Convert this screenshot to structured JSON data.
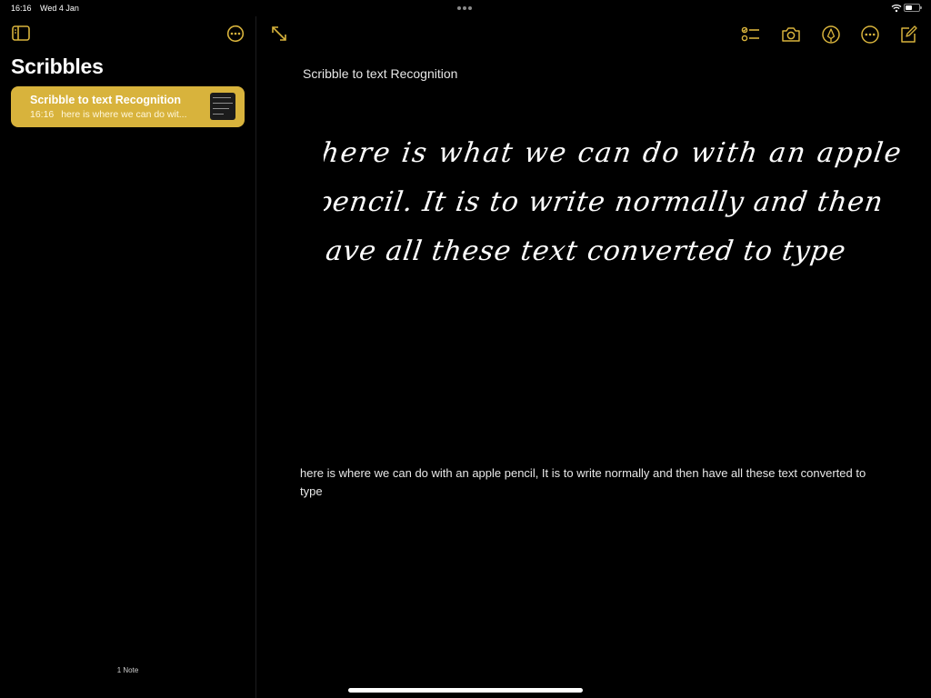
{
  "status_bar": {
    "time": "16:16",
    "date": "Wed 4 Jan"
  },
  "sidebar": {
    "folder_title": "Scribbles",
    "notes": [
      {
        "title": "Scribble to text Recognition",
        "time": "16:16",
        "preview": "here is where we can do wit..."
      }
    ],
    "note_count": "1 Note"
  },
  "editor": {
    "title": "Scribble to text Recognition",
    "handwriting_lines": [
      "here is what we can do with an apple",
      "pencil. It is to write normally and then",
      "have all these text converted to type"
    ],
    "converted_text": "here is where we can do with an apple pencil, It is to write normally and then have all these text converted to type"
  },
  "icons": {
    "sidebar_toggle": "sidebar-icon",
    "more": "ellipsis-circle-icon",
    "expand": "expand-arrows-icon",
    "checklist": "checklist-icon",
    "camera": "camera-icon",
    "markup": "pen-tip-circle-icon",
    "compose": "compose-icon"
  },
  "colors": {
    "accent": "#d8b33c",
    "background": "#000000"
  }
}
